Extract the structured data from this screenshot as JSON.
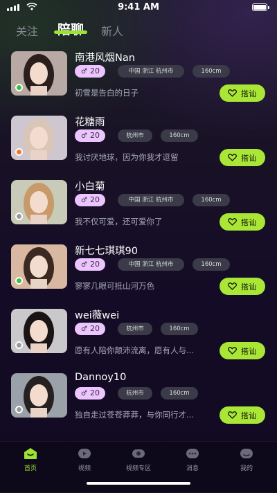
{
  "status_bar": {
    "time": "9:41 AM"
  },
  "tabs": [
    {
      "label": "关注",
      "active": false
    },
    {
      "label": "陪聊",
      "active": true
    },
    {
      "label": "新人",
      "active": false
    }
  ],
  "profiles": [
    {
      "name": "南港风烟Nan",
      "level": "20",
      "tags": [
        "中国 浙江 杭州市",
        "160cm"
      ],
      "bio": "初雪是告白的日子",
      "status_color": "#3fbf3f",
      "button": "搭讪"
    },
    {
      "name": "花糖雨",
      "level": "20",
      "tags": [
        "杭州市",
        "160cm"
      ],
      "bio": "我讨厌地球，因为你我才逗留",
      "status_color": "#ee7a2a",
      "button": "搭讪"
    },
    {
      "name": "小白菊",
      "level": "20",
      "tags": [
        "中国 浙江 杭州市",
        "160cm"
      ],
      "bio": "我不仅可爱，还可爱你了",
      "status_color": "#9a9a9a",
      "button": "搭讪"
    },
    {
      "name": "新七七琪琪90",
      "level": "20",
      "tags": [
        "中国 浙江 杭州市",
        "160cm"
      ],
      "bio": "寥寥几眼可抵山河万色",
      "status_color": "#3fbf3f",
      "button": "搭讪"
    },
    {
      "name": "wei薇wei",
      "level": "20",
      "tags": [
        "杭州市",
        "160cm"
      ],
      "bio": "愿有人陪你颠沛流离，愿有人与...",
      "status_color": "#9a9a9a",
      "button": "搭讪"
    },
    {
      "name": "Dannoy10",
      "level": "20",
      "tags": [
        "杭州市",
        "160cm"
      ],
      "bio": "独自走过苍苍莽莽，与你同行才...",
      "status_color": "#9a9a9a",
      "button": "搭讪"
    }
  ],
  "bottom_nav": [
    {
      "label": "首页",
      "icon": "home-icon",
      "active": true
    },
    {
      "label": "视频",
      "icon": "video-icon",
      "active": false
    },
    {
      "label": "视频专区",
      "icon": "video-zone-icon",
      "active": false
    },
    {
      "label": "消息",
      "icon": "message-icon",
      "active": false
    },
    {
      "label": "我的",
      "icon": "profile-icon",
      "active": false
    }
  ],
  "colors": {
    "accent": "#a9e635",
    "level_badge": "#ecc4ff"
  }
}
